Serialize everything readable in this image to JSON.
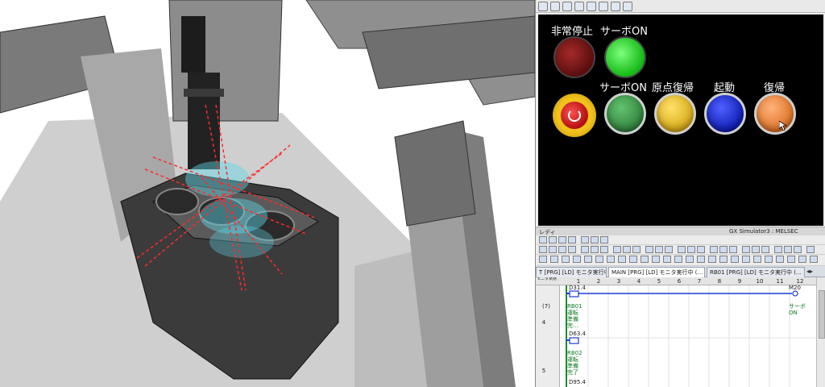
{
  "hmi": {
    "label_emergency_stop": "非常停止",
    "label_servo_on_lamp": "サーボON",
    "label_servo_on_button": "サーボON",
    "label_home_return": "原点復帰",
    "label_start": "起動",
    "label_reset": "復帰",
    "status_left": "レディ",
    "status_right": "GX Simulator3 : MELSEC",
    "colors": {
      "estop_lamp": "#6b1010",
      "servo_lamp": "#1fd21f",
      "servo_button": "#3e9a4a",
      "home_button": "#e9c22a",
      "start_button": "#1b2fd0",
      "reset_button": "#f08a3a",
      "emergency_button": "#d21a1a"
    }
  },
  "gx": {
    "tabs": [
      {
        "label": "T [PRG] [LD] モニタ実行中 …"
      },
      {
        "label": "MAIN [PRG] [LD] モニタ実行中 (…"
      },
      {
        "label": "RB01 [PRG] [LD] モニタ実行中 (…"
      }
    ],
    "column_header_label": "モニタ状態",
    "columns": [
      "1",
      "2",
      "3",
      "4",
      "5",
      "6",
      "7",
      "8",
      "9",
      "10",
      "11",
      "12"
    ],
    "rows": [
      {
        "row_number": "4",
        "step": "(7)",
        "contact_device": "D31.4",
        "contact_comment": "RB01\n運転\n準備\n完…",
        "coil_device": "M20",
        "coil_comment": "サーボ\nON"
      },
      {
        "row_number": "5",
        "contact_device": "D63.4",
        "contact_comment": "RB02\n運転\n準備\n完了",
        "next_device": "D95.4"
      }
    ]
  }
}
